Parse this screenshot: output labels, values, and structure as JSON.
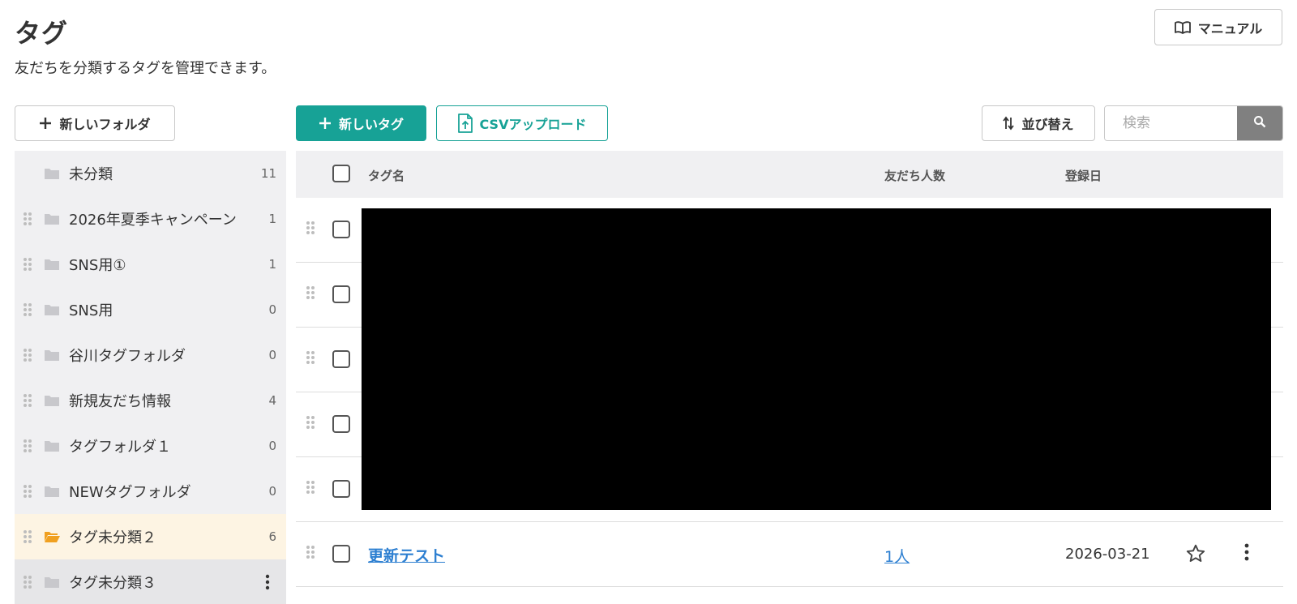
{
  "header": {
    "title": "タグ",
    "description": "友だちを分類するタグを管理できます。",
    "manual_label": "マニュアル"
  },
  "toolbar": {
    "new_folder_label": "新しいフォルダ",
    "new_tag_label": "新しいタグ",
    "csv_upload_label": "CSVアップロード",
    "sort_label": "並び替え",
    "search_placeholder": "検索"
  },
  "sidebar": {
    "folders": [
      {
        "name": "未分類",
        "count": "11"
      },
      {
        "name": "2026年夏季キャンペーン",
        "count": "1"
      },
      {
        "name": "SNS用①",
        "count": "1"
      },
      {
        "name": "SNS用",
        "count": "0"
      },
      {
        "name": "谷川タグフォルダ",
        "count": "0"
      },
      {
        "name": "新規友だち情報",
        "count": "4"
      },
      {
        "name": "タグフォルダ１",
        "count": "0"
      },
      {
        "name": "NEWタグフォルダ",
        "count": "0"
      },
      {
        "name": "タグ未分類２",
        "count": "6",
        "state": "selected"
      },
      {
        "name": "タグ未分類３",
        "count": "",
        "state": "hover"
      }
    ]
  },
  "table": {
    "columns": {
      "name": "タグ名",
      "friends": "友だち人数",
      "date": "登録日"
    },
    "visible_row": {
      "name": "更新テスト",
      "friends": "1人",
      "date": "2026-03-21"
    }
  },
  "colors": {
    "accent": "#17a296",
    "link": "#2d7fd1",
    "selected_folder_bg": "#fdf4e3",
    "selected_folder_icon": "#f0a020",
    "sidebar_bg": "#f0f0f2"
  }
}
